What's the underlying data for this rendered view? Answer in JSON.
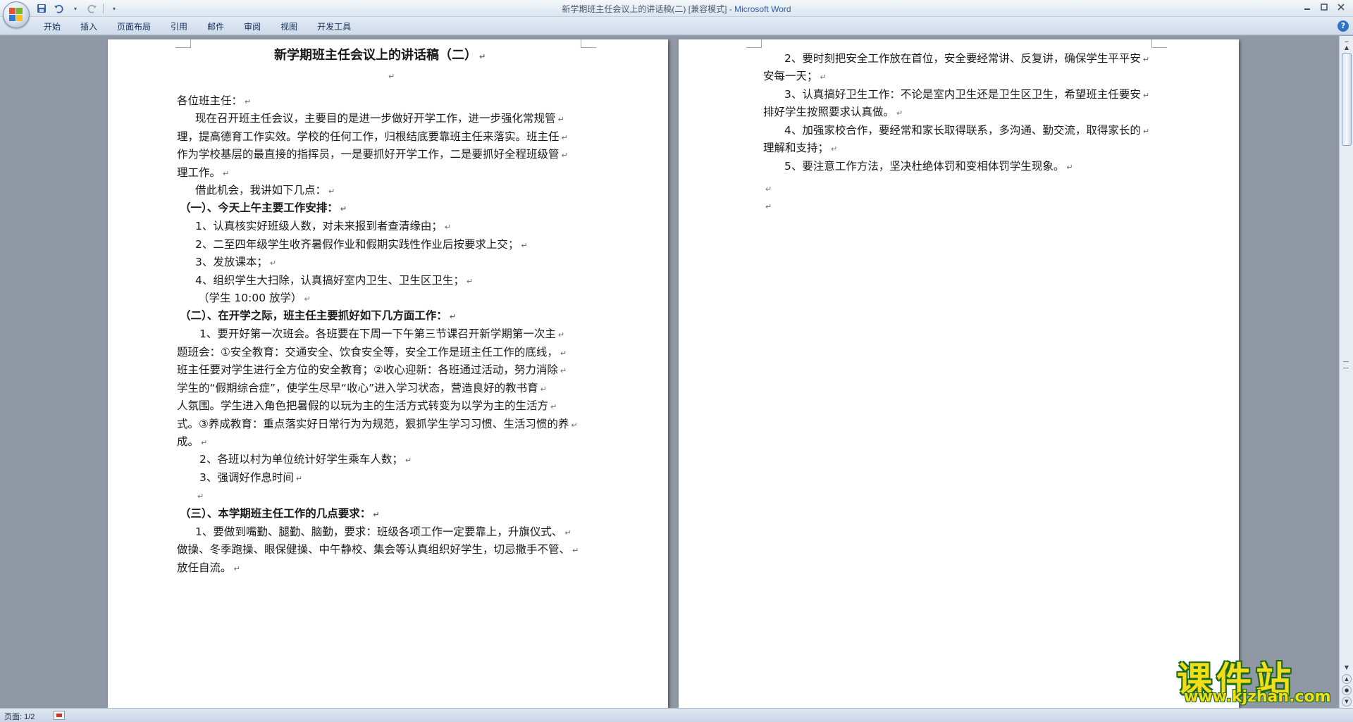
{
  "window": {
    "title_doc": "新学期班主任会议上的讲话稿(二) [兼容模式]",
    "title_sep": " - ",
    "title_app": "Microsoft Word"
  },
  "ribbon": {
    "tabs": [
      "开始",
      "插入",
      "页面布局",
      "引用",
      "邮件",
      "审阅",
      "视图",
      "开发工具"
    ]
  },
  "icons": {
    "office_button": "office-logo-icon",
    "save": "save-icon",
    "undo": "undo-icon",
    "redo": "redo-icon",
    "qat_menu": "chevron-down-icon",
    "help": "help-icon"
  },
  "document": {
    "page1": {
      "title": "新学期班主任会议上的讲话稿（二）",
      "lines": [
        "各位班主任：",
        "现在召开班主任会议，主要目的是进一步做好开学工作，进一步强化常规管",
        "理，提高德育工作实效。学校的任何工作，归根结底要靠班主任来落实。班主任",
        "作为学校基层的最直接的指挥员，一是要抓好开学工作，二是要抓好全程班级管",
        "理工作。",
        "借此机会，我讲如下几点：",
        "（一）、今天上午主要工作安排：",
        "1、认真核实好班级人数，对未来报到者查清缘由；",
        "2、二至四年级学生收齐暑假作业和假期实践性作业后按要求上交；",
        "3、发放课本；",
        "4、组织学生大扫除，认真搞好室内卫生、卫生区卫生；",
        "（学生 10:00 放学）",
        "（二）、在开学之际，班主任主要抓好如下几方面工作：",
        "1、要开好第一次班会。各班要在下周一下午第三节课召开新学期第一次主",
        "题班会：①安全教育：交通安全、饮食安全等，安全工作是班主任工作的底线，",
        "班主任要对学生进行全方位的安全教育；②收心迎新：各班通过活动，努力消除",
        "学生的“假期综合症”，使学生尽早“收心”进入学习状态，营造良好的教书育",
        "人氛围。学生进入角色把暑假的以玩为主的生活方式转变为以学为主的生活方",
        "式。③养成教育：重点落实好日常行为为规范，狠抓学生学习习惯、生活习惯的养",
        "成。",
        "2、各班以村为单位统计好学生乘车人数；",
        "3、强调好作息时间",
        "",
        "（三）、本学期班主任工作的几点要求：",
        "1、要做到嘴勤、腿勤、脑勤，要求：班级各项工作一定要靠上，升旗仪式、",
        "做操、冬季跑操、眼保健操、中午静校、集会等认真组织好学生，切忌撒手不管、",
        "放任自流。"
      ]
    },
    "page2": {
      "lines": [
        "2、要时刻把安全工作放在首位，安全要经常讲、反复讲，确保学生平平安",
        "安每一天；",
        "3、认真搞好卫生工作：不论是室内卫生还是卫生区卫生，希望班主任要安",
        "排好学生按照要求认真做。",
        "4、加强家校合作，要经常和家长取得联系，多沟通、勤交流，取得家长的",
        "理解和支持；",
        "5、要注意工作方法，坚决杜绝体罚和变相体罚学生现象。",
        "",
        ""
      ]
    },
    "paragraph_mark": "↵"
  },
  "statusbar": {
    "page_info": "页面: 1/2"
  },
  "watermark": {
    "name": "课件站",
    "url": "www.kjzhan.com"
  },
  "colors": {
    "doc_background": "#8f98a4",
    "ribbon": "#dbe5f0",
    "app_title": "#2f5fa8",
    "watermark_fill": "#f3dc1a",
    "watermark_outline": "#1a6a1a"
  }
}
